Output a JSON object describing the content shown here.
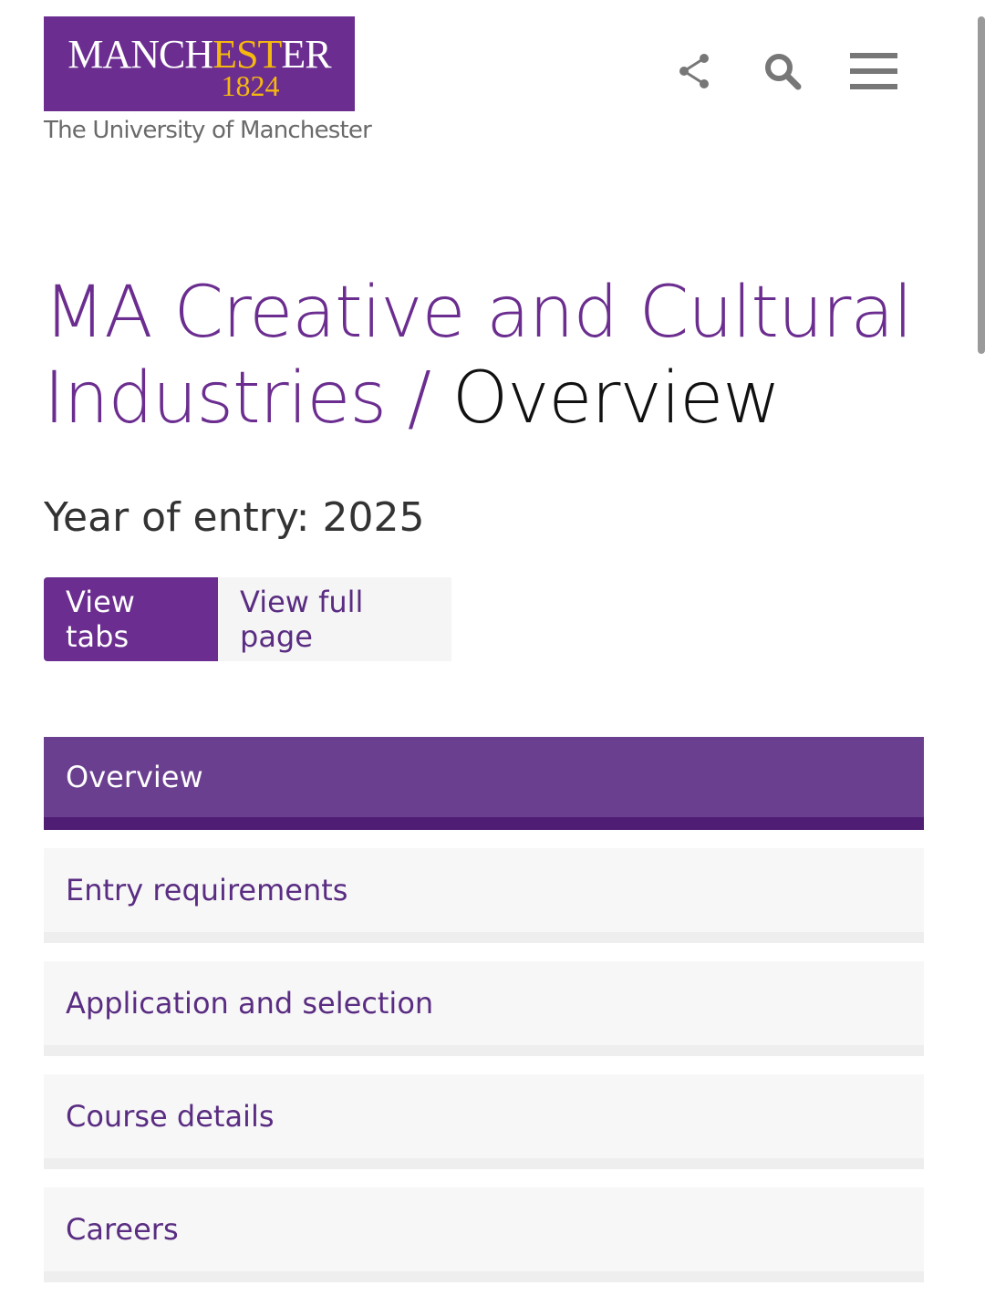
{
  "logo": {
    "word_a": "MANCH",
    "word_b": "EST",
    "word_c": "ER",
    "year": "1824",
    "caption": "The University of Manchester"
  },
  "header_icons": [
    "share-icon",
    "search-icon",
    "menu-icon"
  ],
  "title": {
    "course": "MA Creative and Cultural Industries",
    "separator": " / ",
    "current": "Overview"
  },
  "year_of_entry": "Year of entry: 2025",
  "view_toggle": {
    "tabs_label": "View tabs",
    "full_label": "View full page"
  },
  "tabs": [
    {
      "label": "Overview",
      "active": true
    },
    {
      "label": "Entry requirements",
      "active": false
    },
    {
      "label": "Application and selection",
      "active": false
    },
    {
      "label": "Course details",
      "active": false
    },
    {
      "label": "Careers",
      "active": false
    }
  ],
  "colors": {
    "brand_purple": "#6b2d8f",
    "brand_gold": "#f5b80f",
    "tab_active": "#6b3f8f"
  }
}
